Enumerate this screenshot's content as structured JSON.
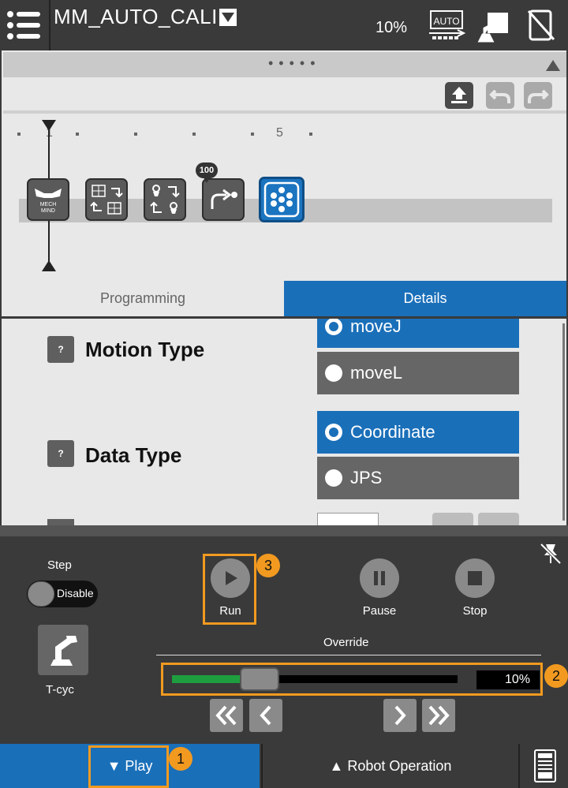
{
  "topbar": {
    "program_name": "MM_AUTO_CALI",
    "speed": "10%",
    "mode_icon_label": "AUTO"
  },
  "program": {
    "collapse_dots": "• • • • •",
    "timeline_marks": [
      "1",
      "5"
    ],
    "mech_mind_label_top": "MECH",
    "mech_mind_label_bottom": "MIND",
    "waypoint_badge": "100"
  },
  "tabs": [
    {
      "label": "Programming",
      "active": false
    },
    {
      "label": "Details",
      "active": true
    }
  ],
  "details": {
    "help_glyph": "?",
    "motion_type": {
      "label": "Motion Type",
      "options": [
        {
          "label": "moveJ",
          "selected": true
        },
        {
          "label": "moveL",
          "selected": false
        }
      ]
    },
    "data_type": {
      "label": "Data Type",
      "options": [
        {
          "label": "Coordinate",
          "selected": true
        },
        {
          "label": "JPS",
          "selected": false
        }
      ]
    }
  },
  "play": {
    "step_label": "Step",
    "step_toggle": "Disable",
    "cycle_label": "T-cyc",
    "run_label": "Run",
    "pause_label": "Pause",
    "stop_label": "Stop",
    "override_label": "Override",
    "override_value": "10%",
    "override_fraction": 0.27
  },
  "callouts": [
    "1",
    "2",
    "3"
  ],
  "bottombar": {
    "play_label": "▼  Play",
    "robot_label": "▲  Robot Operation"
  },
  "colors": {
    "accent": "#1a6fb9",
    "highlight": "#f29a20",
    "slider_fill": "#1e9e3e"
  }
}
